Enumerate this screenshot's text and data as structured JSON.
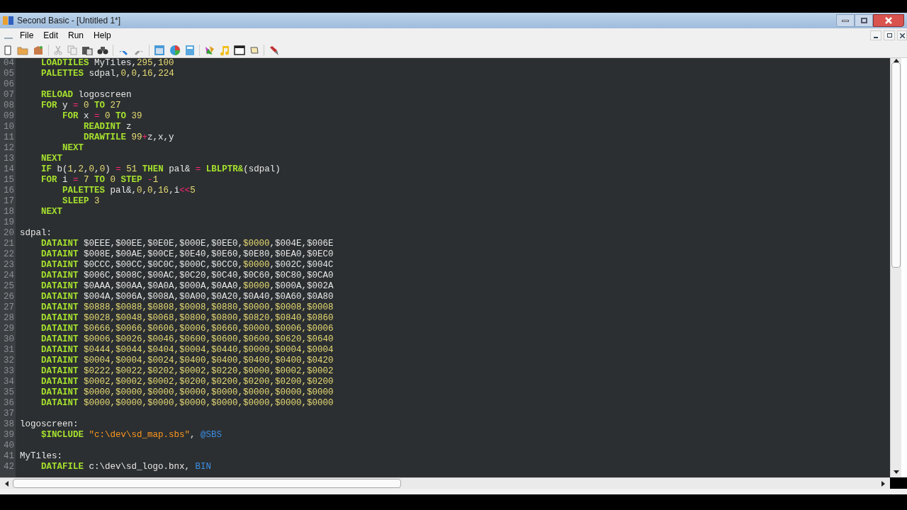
{
  "window": {
    "title": "Second Basic - [Untitled 1*]"
  },
  "menu": [
    {
      "label": "File"
    },
    {
      "label": "Edit"
    },
    {
      "label": "Run"
    },
    {
      "label": "Help"
    }
  ],
  "editor": {
    "lines": [
      {
        "number": "04",
        "tokens": [
          {
            "kind": "keyword",
            "text": "    LOADTILES"
          },
          {
            "kind": "plain",
            "text": " MyTiles,"
          },
          {
            "kind": "number",
            "text": "295"
          },
          {
            "kind": "plain",
            "text": ","
          },
          {
            "kind": "number",
            "text": "100"
          }
        ]
      },
      {
        "number": "05",
        "tokens": [
          {
            "kind": "keyword",
            "text": "    PALETTES"
          },
          {
            "kind": "plain",
            "text": " sdpal,"
          },
          {
            "kind": "number",
            "text": "0"
          },
          {
            "kind": "plain",
            "text": ","
          },
          {
            "kind": "number",
            "text": "0"
          },
          {
            "kind": "plain",
            "text": ","
          },
          {
            "kind": "number",
            "text": "16"
          },
          {
            "kind": "plain",
            "text": ","
          },
          {
            "kind": "number",
            "text": "224"
          }
        ]
      },
      {
        "number": "06"
      },
      {
        "number": "07",
        "tokens": [
          {
            "kind": "keyword",
            "text": "    RELOAD"
          },
          {
            "kind": "plain",
            "text": " logoscreen"
          }
        ]
      },
      {
        "number": "08",
        "tokens": [
          {
            "kind": "keyword",
            "text": "    FOR"
          },
          {
            "kind": "plain",
            "text": " y "
          },
          {
            "kind": "operator",
            "text": "="
          },
          {
            "kind": "number",
            "text": " 0 "
          },
          {
            "kind": "keyword",
            "text": "TO"
          },
          {
            "kind": "number",
            "text": " 27"
          }
        ]
      },
      {
        "number": "09",
        "tokens": [
          {
            "kind": "keyword",
            "text": "        FOR"
          },
          {
            "kind": "plain",
            "text": " x "
          },
          {
            "kind": "operator",
            "text": "="
          },
          {
            "kind": "number",
            "text": " 0 "
          },
          {
            "kind": "keyword",
            "text": "TO"
          },
          {
            "kind": "number",
            "text": " 39"
          }
        ]
      },
      {
        "number": "10",
        "tokens": [
          {
            "kind": "keyword",
            "text": "            READINT"
          },
          {
            "kind": "plain",
            "text": " z"
          }
        ]
      },
      {
        "number": "11",
        "tokens": [
          {
            "kind": "keyword",
            "text": "            DRAWTILE"
          },
          {
            "kind": "number",
            "text": " 99"
          },
          {
            "kind": "operator",
            "text": "+"
          },
          {
            "kind": "plain",
            "text": "z,x,y"
          }
        ]
      },
      {
        "number": "12",
        "tokens": [
          {
            "kind": "keyword",
            "text": "        NEXT"
          }
        ]
      },
      {
        "number": "13",
        "tokens": [
          {
            "kind": "keyword",
            "text": "    NEXT"
          }
        ]
      },
      {
        "number": "14",
        "tokens": [
          {
            "kind": "keyword",
            "text": "    IF"
          },
          {
            "kind": "plain",
            "text": " b("
          },
          {
            "kind": "number",
            "text": "1"
          },
          {
            "kind": "plain",
            "text": ","
          },
          {
            "kind": "number",
            "text": "2"
          },
          {
            "kind": "plain",
            "text": ","
          },
          {
            "kind": "number",
            "text": "0"
          },
          {
            "kind": "plain",
            "text": ","
          },
          {
            "kind": "number",
            "text": "0"
          },
          {
            "kind": "plain",
            "text": ") "
          },
          {
            "kind": "operator",
            "text": "="
          },
          {
            "kind": "number",
            "text": " 51 "
          },
          {
            "kind": "keyword",
            "text": "THEN"
          },
          {
            "kind": "plain",
            "text": " pal& "
          },
          {
            "kind": "operator",
            "text": "="
          },
          {
            "kind": "keyword",
            "text": " LBLPTR&"
          },
          {
            "kind": "plain",
            "text": "(sdpal)"
          }
        ]
      },
      {
        "number": "15",
        "tokens": [
          {
            "kind": "keyword",
            "text": "    FOR"
          },
          {
            "kind": "plain",
            "text": " i "
          },
          {
            "kind": "operator",
            "text": "="
          },
          {
            "kind": "number",
            "text": " 7 "
          },
          {
            "kind": "keyword",
            "text": "TO"
          },
          {
            "kind": "number",
            "text": " 0 "
          },
          {
            "kind": "keyword",
            "text": "STEP"
          },
          {
            "kind": "operator",
            "text": " -"
          },
          {
            "kind": "number",
            "text": "1"
          }
        ]
      },
      {
        "number": "16",
        "tokens": [
          {
            "kind": "keyword",
            "text": "        PALETTES"
          },
          {
            "kind": "plain",
            "text": " pal&,"
          },
          {
            "kind": "number",
            "text": "0"
          },
          {
            "kind": "plain",
            "text": ","
          },
          {
            "kind": "number",
            "text": "0"
          },
          {
            "kind": "plain",
            "text": ","
          },
          {
            "kind": "number",
            "text": "16"
          },
          {
            "kind": "plain",
            "text": ",i"
          },
          {
            "kind": "operator",
            "text": "<<"
          },
          {
            "kind": "number",
            "text": "5"
          }
        ]
      },
      {
        "number": "17",
        "tokens": [
          {
            "kind": "keyword",
            "text": "        SLEEP"
          },
          {
            "kind": "number",
            "text": " 3"
          }
        ]
      },
      {
        "number": "18",
        "tokens": [
          {
            "kind": "keyword",
            "text": "    NEXT"
          }
        ]
      },
      {
        "number": "19"
      },
      {
        "number": "20",
        "tokens": [
          {
            "kind": "plain",
            "text": "sdpal:"
          }
        ]
      },
      {
        "number": "21",
        "tokens": [
          {
            "kind": "keyword",
            "text": "    DATAINT"
          },
          {
            "kind": "plain",
            "text": " $0EEE,$00EE,$0E0E,$000E,$0EE0,"
          },
          {
            "kind": "number",
            "text": "$0000"
          },
          {
            "kind": "plain",
            "text": ",$004E,$006E"
          }
        ]
      },
      {
        "number": "22",
        "tokens": [
          {
            "kind": "keyword",
            "text": "    DATAINT"
          },
          {
            "kind": "plain",
            "text": " $008E,$00AE,$00CE,$0E40,$0E60,$0E80,$0EA0,$0EC0"
          }
        ]
      },
      {
        "number": "23",
        "tokens": [
          {
            "kind": "keyword",
            "text": "    DATAINT"
          },
          {
            "kind": "plain",
            "text": " $0CCC,$00CC,$0C0C,$000C,$0CC0,"
          },
          {
            "kind": "number",
            "text": "$0000"
          },
          {
            "kind": "plain",
            "text": ",$002C,$004C"
          }
        ]
      },
      {
        "number": "24",
        "tokens": [
          {
            "kind": "keyword",
            "text": "    DATAINT"
          },
          {
            "kind": "plain",
            "text": " $006C,$008C,$00AC,$0C20,$0C40,$0C60,$0C80,$0CA0"
          }
        ]
      },
      {
        "number": "25",
        "tokens": [
          {
            "kind": "keyword",
            "text": "    DATAINT"
          },
          {
            "kind": "plain",
            "text": " $0AAA,$00AA,$0A0A,$000A,$0AA0,"
          },
          {
            "kind": "number",
            "text": "$0000"
          },
          {
            "kind": "plain",
            "text": ",$000A,$002A"
          }
        ]
      },
      {
        "number": "26",
        "tokens": [
          {
            "kind": "keyword",
            "text": "    DATAINT"
          },
          {
            "kind": "plain",
            "text": " $004A,$006A,$008A,$0A00,$0A20,$0A40,$0A60,$0A80"
          }
        ]
      },
      {
        "number": "27",
        "tokens": [
          {
            "kind": "keyword",
            "text": "    DATAINT"
          },
          {
            "kind": "number",
            "text": " $0888,$0088,$0808,$0008,$0880,$0000,$0008,$0008"
          }
        ]
      },
      {
        "number": "28",
        "tokens": [
          {
            "kind": "keyword",
            "text": "    DATAINT"
          },
          {
            "kind": "number",
            "text": " $0028,$0048,$0068,$0800,$0800,$0820,$0840,$0860"
          }
        ]
      },
      {
        "number": "29",
        "tokens": [
          {
            "kind": "keyword",
            "text": "    DATAINT"
          },
          {
            "kind": "number",
            "text": " $0666,$0066,$0606,$0006,$0660,$0000,$0006,$0006"
          }
        ]
      },
      {
        "number": "30",
        "tokens": [
          {
            "kind": "keyword",
            "text": "    DATAINT"
          },
          {
            "kind": "number",
            "text": " $0006,$0026,$0046,$0600,$0600,$0600,$0620,$0640"
          }
        ]
      },
      {
        "number": "31",
        "tokens": [
          {
            "kind": "keyword",
            "text": "    DATAINT"
          },
          {
            "kind": "number",
            "text": " $0444,$0044,$0404,$0004,$0440,$0000,$0004,$0004"
          }
        ]
      },
      {
        "number": "32",
        "tokens": [
          {
            "kind": "keyword",
            "text": "    DATAINT"
          },
          {
            "kind": "number",
            "text": " $0004,$0004,$0024,$0400,$0400,$0400,$0400,$0420"
          }
        ]
      },
      {
        "number": "33",
        "tokens": [
          {
            "kind": "keyword",
            "text": "    DATAINT"
          },
          {
            "kind": "number",
            "text": " $0222,$0022,$0202,$0002,$0220,$0000,$0002,$0002"
          }
        ]
      },
      {
        "number": "34",
        "tokens": [
          {
            "kind": "keyword",
            "text": "    DATAINT"
          },
          {
            "kind": "number",
            "text": " $0002,$0002,$0002,$0200,$0200,$0200,$0200,$0200"
          }
        ]
      },
      {
        "number": "35",
        "tokens": [
          {
            "kind": "keyword",
            "text": "    DATAINT"
          },
          {
            "kind": "number",
            "text": " $0000,$0000,$0000,$0000,$0000,$0000,$0000,$0000"
          }
        ]
      },
      {
        "number": "36",
        "tokens": [
          {
            "kind": "keyword",
            "text": "    DATAINT"
          },
          {
            "kind": "number",
            "text": " $0000,$0000,$0000,$0000,$0000,$0000,$0000,$0000"
          }
        ]
      },
      {
        "number": "37"
      },
      {
        "number": "38",
        "tokens": [
          {
            "kind": "plain",
            "text": "logoscreen:"
          }
        ]
      },
      {
        "number": "39",
        "tokens": [
          {
            "kind": "keyword",
            "text": "    $INCLUDE"
          },
          {
            "kind": "string",
            "text": " \"c:\\dev\\sd_map.sbs\""
          },
          {
            "kind": "plain",
            "text": ", "
          },
          {
            "kind": "directive",
            "text": "@SBS"
          }
        ]
      },
      {
        "number": "40"
      },
      {
        "number": "41",
        "tokens": [
          {
            "kind": "plain",
            "text": "MyTiles:"
          }
        ]
      },
      {
        "number": "42",
        "tokens": [
          {
            "kind": "keyword",
            "text": "    DATAFILE"
          },
          {
            "kind": "plain",
            "text": " c:\\dev\\sd_logo.bnx, "
          },
          {
            "kind": "directive",
            "text": "BIN"
          }
        ]
      }
    ]
  }
}
